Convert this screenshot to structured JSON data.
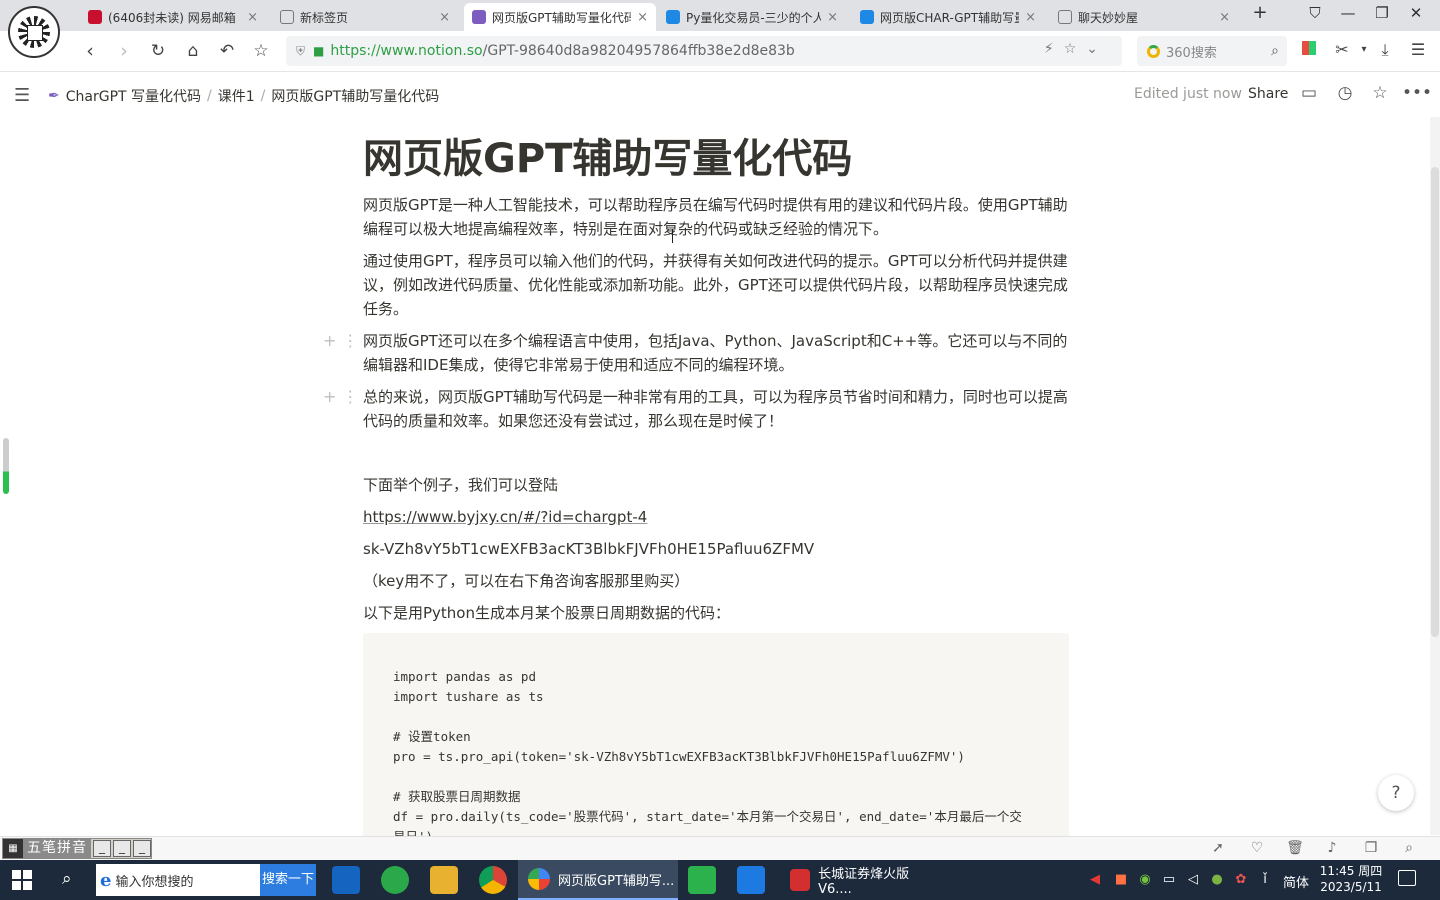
{
  "browser": {
    "tabs": [
      {
        "label": "(6406封未读) 网易邮箱",
        "close": "×",
        "color": "#c8102e"
      },
      {
        "label": "新标签页",
        "close": "×",
        "color": "#888888"
      },
      {
        "label": "网页版GPT辅助写量化代码",
        "close": "×",
        "color": "#7c5cbf"
      },
      {
        "label": "Py量化交易员-三少的个人",
        "close": "×",
        "color": "#1e88e5"
      },
      {
        "label": "网页版CHAR-GPT辅助写量化",
        "close": "×",
        "color": "#1e88e5"
      },
      {
        "label": "聊天妙妙屋",
        "close": "×",
        "color": "#888888"
      }
    ],
    "new_tab": "+",
    "url_host": "https://www.notion.so",
    "url_path": "/GPT-98640d8a98204957864ffb38e2d8e83b",
    "search_placeholder": "360搜索"
  },
  "notion": {
    "breadcrumbs": [
      "CharGPT 写量化代码",
      "课件1",
      "网页版GPT辅助写量化代码"
    ],
    "edited": "Edited just now",
    "share": "Share"
  },
  "page": {
    "title": "网页版GPT辅助写量化代码",
    "paragraphs": [
      "网页版GPT是一种人工智能技术，可以帮助程序员在编写代码时提供有用的建议和代码片段。使用GPT辅助编程可以极大地提高编程效率，特别是在面对复杂的代码或缺乏经验的情况下。",
      "通过使用GPT，程序员可以输入他们的代码，并获得有关如何改进代码的提示。GPT可以分析代码并提供建议，例如改进代码质量、优化性能或添加新功能。此外，GPT还可以提供代码片段，以帮助程序员快速完成任务。",
      "网页版GPT还可以在多个编程语言中使用，包括Java、Python、JavaScript和C++等。它还可以与不同的编辑器和IDE集成，使得它非常易于使用和适应不同的编程环境。",
      "总的来说，网页版GPT辅助写代码是一种非常有用的工具，可以为程序员节省时间和精力，同时也可以提高代码的质量和效率。如果您还没有尝试过，那么现在是时候了！"
    ],
    "example_intro": "下面举个例子，我们可以登陆",
    "link": "https://www.byjxy.cn/#/?id=chargpt-4",
    "key": "sk-VZh8vY5bT1cwEXFB3acKT3BlbkFJVFh0HE15Pafluu6ZFMV",
    "key_note": "（key用不了，可以在右下角咨询客服那里购买）",
    "code_intro": "以下是用Python生成本月某个股票日周期数据的代码：",
    "code": "import pandas as pd\nimport tushare as ts\n\n# 设置token\npro = ts.pro_api(token='sk-VZh8vY5bT1cwEXFB3acKT3BlbkFJVFh0HE15Pafluu6ZFMV')\n\n# 获取股票日周期数据\ndf = pro.daily(ts_code='股票代码', start_date='本月第一个交易日', end_date='本月最后一个交\n易日')",
    "help": "?"
  },
  "statusbar": {
    "ime_label": "五笔拼音"
  },
  "taskbar": {
    "search_placeholder": "输入你想搜的",
    "search_button": "搜索一下",
    "task_browser": "网页版GPT辅助写...",
    "task_stock": "长城证券烽火版V6....",
    "lang": "简体",
    "time": "11:45 周四",
    "date": "2023/5/11"
  }
}
